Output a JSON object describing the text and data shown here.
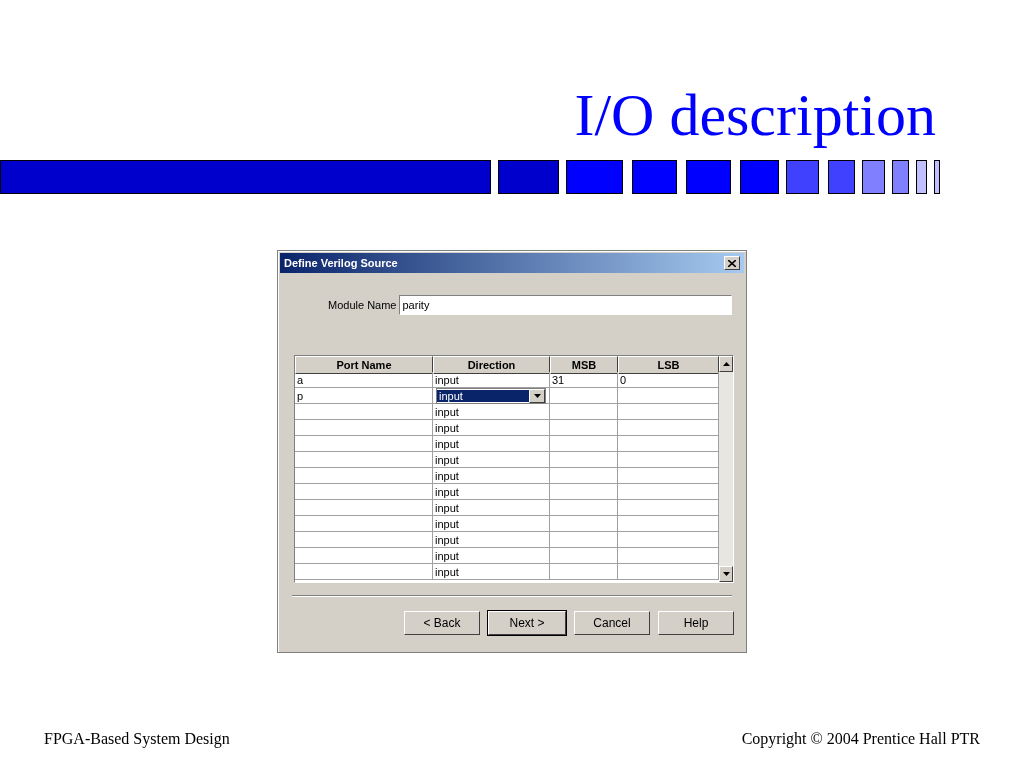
{
  "slide": {
    "title": "I/O description",
    "footer_left": "FPGA-Based System Design",
    "footer_right": "Copyright © 2004 Prentice Hall PTR"
  },
  "dialog": {
    "title": "Define Verilog Source",
    "module_label": "Module Name",
    "module_value": "parity",
    "columns": [
      "Port Name",
      "Direction",
      "MSB",
      "LSB"
    ],
    "rows": [
      {
        "port": "a",
        "direction": "input",
        "msb": "31",
        "lsb": "0",
        "selected": false
      },
      {
        "port": "p",
        "direction": "input",
        "selected": true
      },
      {
        "direction": "input",
        "selected": false
      },
      {
        "direction": "input",
        "selected": false
      },
      {
        "direction": "input",
        "selected": false
      },
      {
        "direction": "input",
        "selected": false
      },
      {
        "direction": "input",
        "selected": false
      },
      {
        "direction": "input",
        "selected": false
      },
      {
        "direction": "input",
        "selected": false
      },
      {
        "direction": "input",
        "selected": false
      },
      {
        "direction": "input",
        "selected": false
      },
      {
        "direction": "input",
        "selected": false
      },
      {
        "direction": "input",
        "selected": false
      }
    ],
    "buttons": [
      {
        "label": "< Back",
        "default": false
      },
      {
        "label": "Next >",
        "default": true
      },
      {
        "label": "Cancel",
        "default": false
      },
      {
        "label": "Help",
        "default": false
      }
    ]
  }
}
